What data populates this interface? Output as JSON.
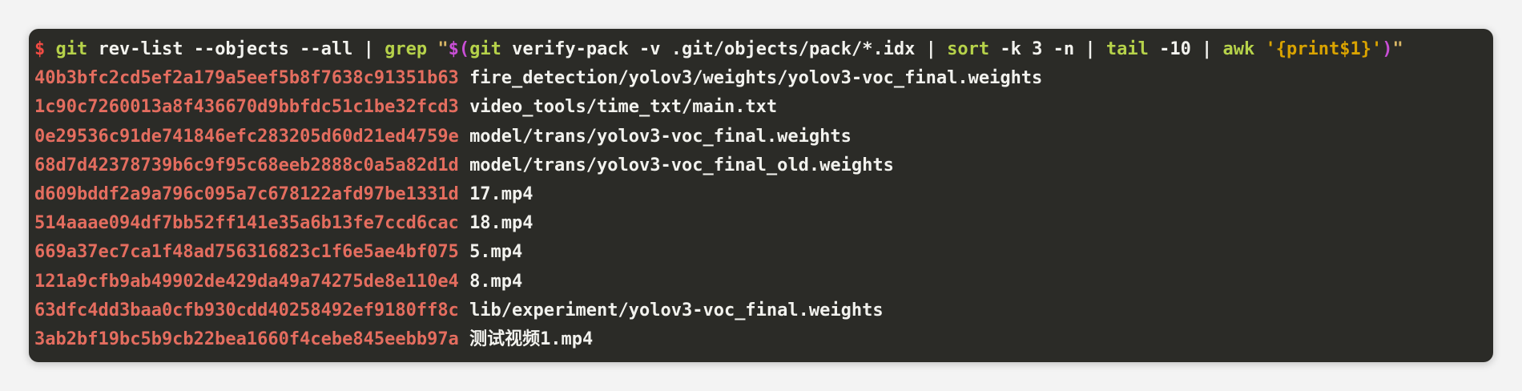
{
  "command": {
    "prompt": "$",
    "git": "git",
    "args1": " rev-list --objects --all | ",
    "grep": "grep",
    "quote_open": " \"",
    "subst_open": "$(",
    "git2": "git",
    "args2": " verify-pack -v .git/objects/pack/*.idx | ",
    "sort": "sort",
    "args3": " -k 3 -n | ",
    "tail": "tail",
    "args4": " -10 | ",
    "awk": "awk",
    "awk_script": " '{print$1}'",
    "subst_close": ")",
    "quote_close": "\""
  },
  "results": [
    {
      "hash": "40b3bfc2cd5ef2a179a5eef5b8f7638c91351b63",
      "path": "fire_detection/yolov3/weights/yolov3-voc_final.weights"
    },
    {
      "hash": "1c90c7260013a8f436670d9bbfdc51c1be32fcd3",
      "path": "video_tools/time_txt/main.txt"
    },
    {
      "hash": "0e29536c91de741846efc283205d60d21ed4759e",
      "path": "model/trans/yolov3-voc_final.weights"
    },
    {
      "hash": "68d7d42378739b6c9f95c68eeb2888c0a5a82d1d",
      "path": "model/trans/yolov3-voc_final_old.weights"
    },
    {
      "hash": "d609bddf2a9a796c095a7c678122afd97be1331d",
      "path": "17.mp4"
    },
    {
      "hash": "514aaae094df7bb52ff141e35a6b13fe7ccd6cac",
      "path": "18.mp4"
    },
    {
      "hash": "669a37ec7ca1f48ad756316823c1f6e5ae4bf075",
      "path": "5.mp4"
    },
    {
      "hash": "121a9cfb9ab49902de429da49a74275de8e110e4",
      "path": "8.mp4"
    },
    {
      "hash": "63dfc4dd3baa0cfb930cdd40258492ef9180ff8c",
      "path": "lib/experiment/yolov3-voc_final.weights"
    },
    {
      "hash": "3ab2bf19bc5b9cb22bea1660f4cebe845eebb97a",
      "path": "测试视频1.mp4"
    }
  ],
  "colors": {
    "background": "#2b2b27",
    "prompt": "#f04b43",
    "command": "#b6d24a",
    "hash": "#e46d5f",
    "text": "#f2f2ee",
    "substitution": "#c94fd6",
    "awk_string": "#d9a300"
  }
}
